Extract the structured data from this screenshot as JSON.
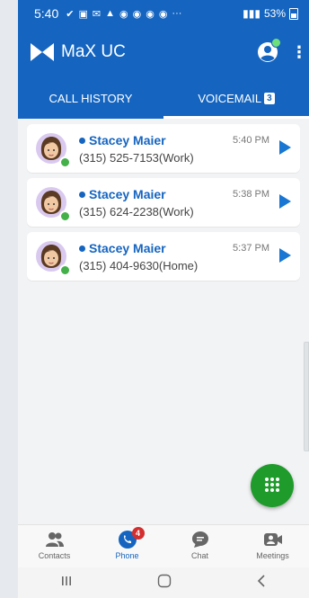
{
  "status": {
    "time": "5:40",
    "battery": "53%"
  },
  "app": {
    "title": "MaX UC"
  },
  "tabs": [
    {
      "label": "CALL HISTORY",
      "active": false
    },
    {
      "label": "VOICEMAIL",
      "badge": "3",
      "active": true
    }
  ],
  "voicemails": [
    {
      "name": "Stacey Maier",
      "number": "(315) 525-7153(Work)",
      "time": "5:40 PM"
    },
    {
      "name": "Stacey Maier",
      "number": "(315) 624-2238(Work)",
      "time": "5:38 PM"
    },
    {
      "name": "Stacey Maier",
      "number": "(315) 404-9630(Home)",
      "time": "5:37 PM"
    }
  ],
  "bottom_nav": [
    {
      "label": "Contacts",
      "icon": "contacts-icon"
    },
    {
      "label": "Phone",
      "icon": "phone-icon",
      "badge": "4",
      "active": true
    },
    {
      "label": "Chat",
      "icon": "chat-icon"
    },
    {
      "label": "Meetings",
      "icon": "meetings-icon"
    }
  ],
  "colors": {
    "primary": "#1565c0",
    "fab": "#1f9b2b",
    "presence": "#43b04a",
    "badge": "#d32f2f"
  }
}
